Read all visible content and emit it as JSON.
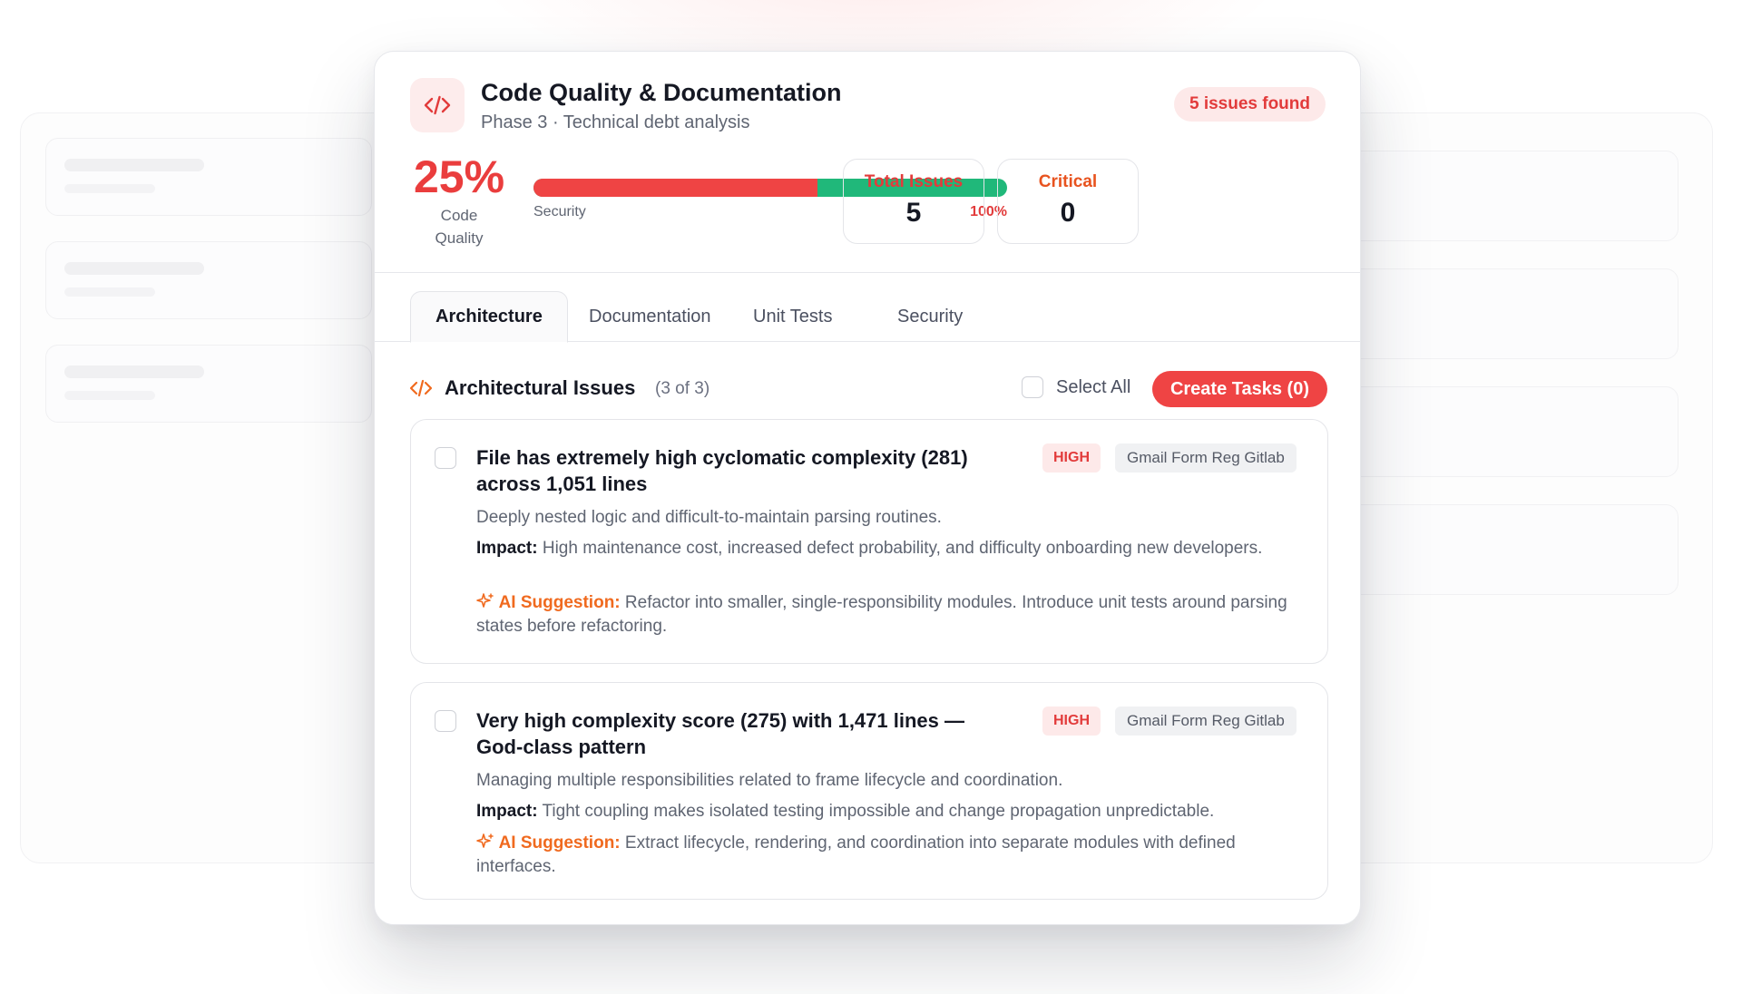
{
  "header": {
    "title": "Code Quality & Documentation",
    "subtitle": "Phase 3 · Technical debt analysis",
    "issues_found": "5 issues found",
    "logo_icon": "code-icon"
  },
  "score": {
    "value": "25%",
    "label_line1": "Code",
    "label_line2": "Quality"
  },
  "progress": {
    "left_label": "Security",
    "right_label": "100%",
    "red_fraction": 0.6,
    "red_color": "#ef4444",
    "green_color": "#20b87a"
  },
  "stats": [
    {
      "label": "Total Issues",
      "value": "5",
      "color": "#e23b3b"
    },
    {
      "label": "Critical",
      "value": "0",
      "color": "#e8531f"
    }
  ],
  "tabs": [
    {
      "label": "Architecture",
      "active": true
    },
    {
      "label": "Documentation",
      "active": false
    },
    {
      "label": "Unit Tests",
      "active": false
    },
    {
      "label": "Security",
      "active": false
    }
  ],
  "section": {
    "icon": "code-icon",
    "title": "Architectural Issues",
    "count": "(3 of 3)",
    "select_all": "Select All",
    "create_button": "Create Tasks (0)"
  },
  "issues": [
    {
      "title": "File has extremely high cyclomatic complexity (281) across 1,051 lines",
      "severity": "HIGH",
      "repo": "Gmail Form Reg Gitlab",
      "description": "Deeply nested logic and difficult-to-maintain parsing routines.",
      "impact_label": "Impact:",
      "impact": "High maintenance cost, increased defect probability, and difficulty onboarding new developers.",
      "ai_label": "AI Suggestion:",
      "suggestion": "Refactor into smaller, single-responsibility modules. Introduce unit tests around parsing states before refactoring."
    },
    {
      "title": "Very high complexity score (275) with 1,471 lines — God-class pattern",
      "severity": "HIGH",
      "repo": "Gmail Form Reg Gitlab",
      "description": "Managing multiple responsibilities related to frame lifecycle and coordination.",
      "impact_label": "Impact:",
      "impact": "Tight coupling makes isolated testing impossible and change propagation unpredictable.",
      "ai_label": "AI Suggestion:",
      "suggestion": "Extract lifecycle, rendering, and coordination into separate modules with defined interfaces."
    }
  ]
}
